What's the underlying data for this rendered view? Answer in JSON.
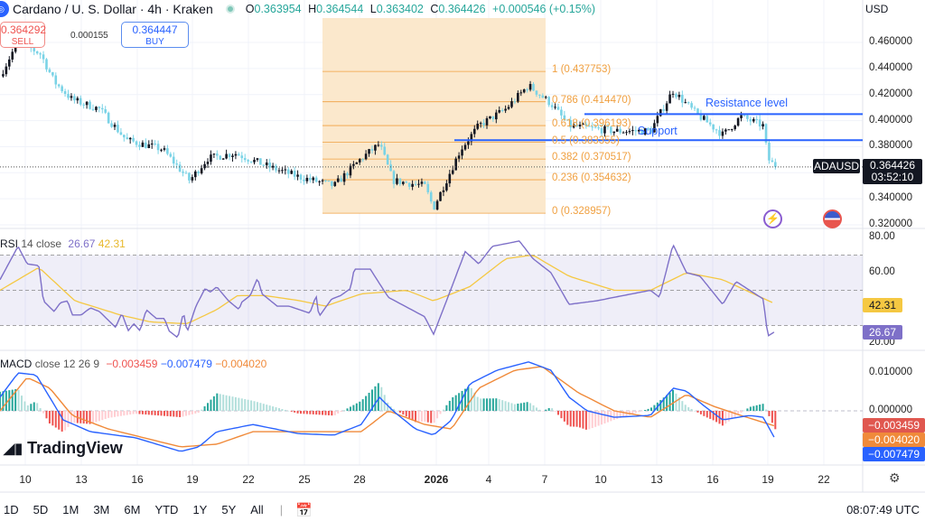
{
  "header": {
    "title": "Cardano / U. S. Dollar · 4h · Kraken",
    "o_label": "O",
    "o": "0.363954",
    "h_label": "H",
    "h": "0.364544",
    "l_label": "L",
    "l": "0.363402",
    "c_label": "C",
    "c": "0.364426",
    "change": "+0.000546 (+0.15%)"
  },
  "trade": {
    "sell_price": "0.364292",
    "sell_label": "SELL",
    "spread": "0.000155",
    "buy_price": "0.364447",
    "buy_label": "BUY"
  },
  "currency": "USD",
  "price_axis": [
    "0.460000",
    "0.440000",
    "0.420000",
    "0.400000",
    "0.380000",
    "0.340000",
    "0.320000"
  ],
  "price_axis_values": [
    0.46,
    0.44,
    0.42,
    0.4,
    0.38,
    0.34,
    0.32
  ],
  "symbol_tag": "ADAUSD",
  "last_price": "0.364426",
  "countdown": "03:52:10",
  "fib_levels": [
    {
      "label": "1 (0.437753)",
      "value": 0.437753
    },
    {
      "label": "0.786 (0.414470)",
      "value": 0.41447
    },
    {
      "label": "0.618 (0.396193)",
      "value": 0.396193
    },
    {
      "label": "0.5 (0.383355)",
      "value": 0.383355
    },
    {
      "label": "0.382 (0.370517)",
      "value": 0.370517
    },
    {
      "label": "0.236 (0.354632)",
      "value": 0.354632
    },
    {
      "label": "0 (0.328957)",
      "value": 0.328957
    }
  ],
  "annotations": {
    "resistance": "Resistance level",
    "resistance_value": 0.405,
    "support": "Support",
    "support_value": 0.385
  },
  "rsi": {
    "name": "RSI",
    "params": "14 close",
    "value": "26.67",
    "ma": "42.31",
    "axis": [
      "80.00",
      "60.00",
      "20.00"
    ]
  },
  "macd": {
    "name": "MACD",
    "params": "close 12 26 9",
    "hist": "−0.003459",
    "macd": "−0.007479",
    "signal": "−0.004020",
    "axis": [
      "0.010000",
      "0.000000"
    ],
    "tag_hist": "−0.003459",
    "tag_signal": "−0.004020",
    "tag_macd": "−0.007479"
  },
  "time_labels": [
    "10",
    "13",
    "16",
    "19",
    "22",
    "25",
    "28",
    "2026",
    "4",
    "7",
    "10",
    "13",
    "16",
    "19",
    "22"
  ],
  "toolbar": {
    "ranges": [
      "1D",
      "5D",
      "1M",
      "3M",
      "6M",
      "YTD",
      "1Y",
      "5Y",
      "All"
    ],
    "clock": "08:07:49 UTC"
  },
  "brand": "TradingView",
  "colors": {
    "up": "#131722",
    "down": "#7ad3e6",
    "fib": "#f0a040",
    "fib_zone": "#fbe8cc",
    "line": "#2962ff",
    "rsi": "#7e70c8",
    "rsi_ma": "#f5c842",
    "macd": "#2962ff",
    "signal": "#f08a3a"
  },
  "chart_data": {
    "type": "candlestick",
    "title": "Cardano / U. S. Dollar · 4h · Kraken",
    "x_unit": "days since Dec 10",
    "ylim": [
      0.315,
      0.47
    ],
    "close_keypoints": [
      [
        -1.36,
        0.434
      ],
      [
        -0.39,
        0.461
      ],
      [
        0.83,
        0.451
      ],
      [
        1.55,
        0.43
      ],
      [
        2.52,
        0.416
      ],
      [
        3.98,
        0.409
      ],
      [
        5.44,
        0.385
      ],
      [
        7.38,
        0.378
      ],
      [
        8.83,
        0.354
      ],
      [
        9.8,
        0.371
      ],
      [
        11.26,
        0.375
      ],
      [
        13.2,
        0.364
      ],
      [
        14.66,
        0.357
      ],
      [
        16.6,
        0.35
      ],
      [
        18.06,
        0.371
      ],
      [
        19.03,
        0.382
      ],
      [
        19.76,
        0.354
      ],
      [
        21.46,
        0.35
      ],
      [
        21.94,
        0.333
      ],
      [
        23.4,
        0.378
      ],
      [
        24.37,
        0.396
      ],
      [
        25.83,
        0.409
      ],
      [
        27.04,
        0.427
      ],
      [
        28.25,
        0.413
      ],
      [
        29.22,
        0.396
      ],
      [
        31.65,
        0.392
      ],
      [
        33.6,
        0.392
      ],
      [
        34.8,
        0.423
      ],
      [
        36.0,
        0.406
      ],
      [
        37.5,
        0.389
      ],
      [
        38.45,
        0.403
      ],
      [
        39.66,
        0.396
      ],
      [
        39.9,
        0.371
      ],
      [
        40.3,
        0.364426
      ]
    ],
    "rsi": [
      [
        -1.36,
        56
      ],
      [
        -0.39,
        75
      ],
      [
        0.1,
        65
      ],
      [
        0.73,
        64
      ],
      [
        0.97,
        44
      ],
      [
        1.55,
        38
      ],
      [
        1.89,
        43
      ],
      [
        2.28,
        44
      ],
      [
        2.52,
        36
      ],
      [
        3.01,
        36
      ],
      [
        3.5,
        40
      ],
      [
        3.98,
        38
      ],
      [
        4.85,
        29
      ],
      [
        5.19,
        37
      ],
      [
        5.53,
        27
      ],
      [
        5.83,
        31
      ],
      [
        6.17,
        27
      ],
      [
        6.5,
        39
      ],
      [
        7.04,
        34
      ],
      [
        7.48,
        34
      ],
      [
        7.72,
        27
      ],
      [
        8.2,
        23
      ],
      [
        8.5,
        38
      ],
      [
        8.69,
        26
      ],
      [
        9.17,
        41
      ],
      [
        9.66,
        51
      ],
      [
        9.95,
        49
      ],
      [
        10.29,
        52
      ],
      [
        10.92,
        44
      ],
      [
        11.5,
        39
      ],
      [
        11.6,
        43
      ],
      [
        12.09,
        47
      ],
      [
        12.48,
        57
      ],
      [
        12.72,
        48
      ],
      [
        13.54,
        41
      ],
      [
        14.17,
        41
      ],
      [
        15.29,
        37
      ],
      [
        15.63,
        47
      ],
      [
        15.78,
        35
      ],
      [
        16.46,
        45
      ],
      [
        16.94,
        47
      ],
      [
        17.48,
        51
      ],
      [
        17.67,
        62
      ],
      [
        18.54,
        62
      ],
      [
        19.51,
        46
      ],
      [
        21.46,
        35
      ],
      [
        21.94,
        25
      ],
      [
        22.67,
        45
      ],
      [
        23.64,
        72
      ],
      [
        24.37,
        65
      ],
      [
        25.1,
        75
      ],
      [
        26.55,
        78
      ],
      [
        27.28,
        68
      ],
      [
        28.25,
        60
      ],
      [
        29.22,
        42
      ],
      [
        30.68,
        44
      ],
      [
        32.62,
        48
      ],
      [
        33.6,
        50
      ],
      [
        34.08,
        46
      ],
      [
        34.81,
        76
      ],
      [
        35.53,
        60
      ],
      [
        36.26,
        58
      ],
      [
        37.48,
        42
      ],
      [
        38.2,
        55
      ],
      [
        38.93,
        50
      ],
      [
        39.66,
        45
      ],
      [
        39.9,
        24
      ],
      [
        40.3,
        26.67
      ]
    ],
    "rsi_ma": [
      [
        -1.36,
        50
      ],
      [
        0.73,
        63
      ],
      [
        2.67,
        44
      ],
      [
        5.1,
        36
      ],
      [
        6.75,
        32
      ],
      [
        8.69,
        31
      ],
      [
        10.29,
        39
      ],
      [
        11.41,
        47
      ],
      [
        12.86,
        47
      ],
      [
        14.81,
        44
      ],
      [
        16.12,
        41
      ],
      [
        18.06,
        48
      ],
      [
        20.5,
        50
      ],
      [
        21.94,
        44
      ],
      [
        23.88,
        52
      ],
      [
        25.83,
        68
      ],
      [
        27.28,
        70
      ],
      [
        29.22,
        58
      ],
      [
        31.65,
        50
      ],
      [
        33.6,
        50
      ],
      [
        35.53,
        60
      ],
      [
        37.48,
        56
      ],
      [
        40.3,
        42.31
      ]
    ],
    "rsi_ylim": [
      20,
      80
    ],
    "rsi_bands": [
      70,
      50,
      30
    ],
    "macd": [
      [
        -1.36,
        0.0036
      ],
      [
        -0.39,
        0.01
      ],
      [
        0.58,
        0.0095
      ],
      [
        1.31,
        0.0036
      ],
      [
        2.04,
        -0.0024
      ],
      [
        3.5,
        -0.0055
      ],
      [
        5.92,
        -0.0071
      ],
      [
        8.35,
        -0.0107
      ],
      [
        9.32,
        -0.0095
      ],
      [
        10.29,
        -0.0055
      ],
      [
        12.23,
        -0.0036
      ],
      [
        14.66,
        -0.006
      ],
      [
        16.6,
        -0.0064
      ],
      [
        18.06,
        -0.0036
      ],
      [
        19.03,
        0.0036
      ],
      [
        19.76,
        0
      ],
      [
        20.97,
        -0.0048
      ],
      [
        21.94,
        -0.0064
      ],
      [
        22.91,
        -0.0024
      ],
      [
        23.88,
        0.0071
      ],
      [
        25.34,
        0.0107
      ],
      [
        27.04,
        0.0129
      ],
      [
        28.25,
        0.0107
      ],
      [
        29.22,
        0.0036
      ],
      [
        30.19,
        0
      ],
      [
        31.65,
        -0.0017
      ],
      [
        33.6,
        -0.0012
      ],
      [
        34.81,
        0.006
      ],
      [
        35.53,
        0.0052
      ],
      [
        36.5,
        0.0012
      ],
      [
        37.48,
        -0.0024
      ],
      [
        38.93,
        -0.0012
      ],
      [
        39.66,
        -0.0017
      ],
      [
        40.3,
        -0.007479
      ]
    ],
    "signal": [
      [
        -1.36,
        0
      ],
      [
        0.1,
        0.0088
      ],
      [
        1.31,
        0.006
      ],
      [
        2.52,
        -0.0012
      ],
      [
        4.47,
        -0.0048
      ],
      [
        8.35,
        -0.0095
      ],
      [
        10.29,
        -0.0088
      ],
      [
        12.23,
        -0.0055
      ],
      [
        15.15,
        -0.0055
      ],
      [
        18.06,
        -0.0055
      ],
      [
        19.51,
        0
      ],
      [
        21.46,
        -0.0036
      ],
      [
        22.91,
        -0.0048
      ],
      [
        24.37,
        0.006
      ],
      [
        26.31,
        0.0107
      ],
      [
        27.77,
        0.0117
      ],
      [
        29.71,
        0.0048
      ],
      [
        31.65,
        0
      ],
      [
        33.6,
        -0.0017
      ],
      [
        35.53,
        0.0043
      ],
      [
        36.99,
        0.0012
      ],
      [
        38.45,
        -0.0012
      ],
      [
        40.3,
        -0.00402
      ]
    ],
    "macd_ylim": [
      -0.012,
      0.014
    ]
  }
}
